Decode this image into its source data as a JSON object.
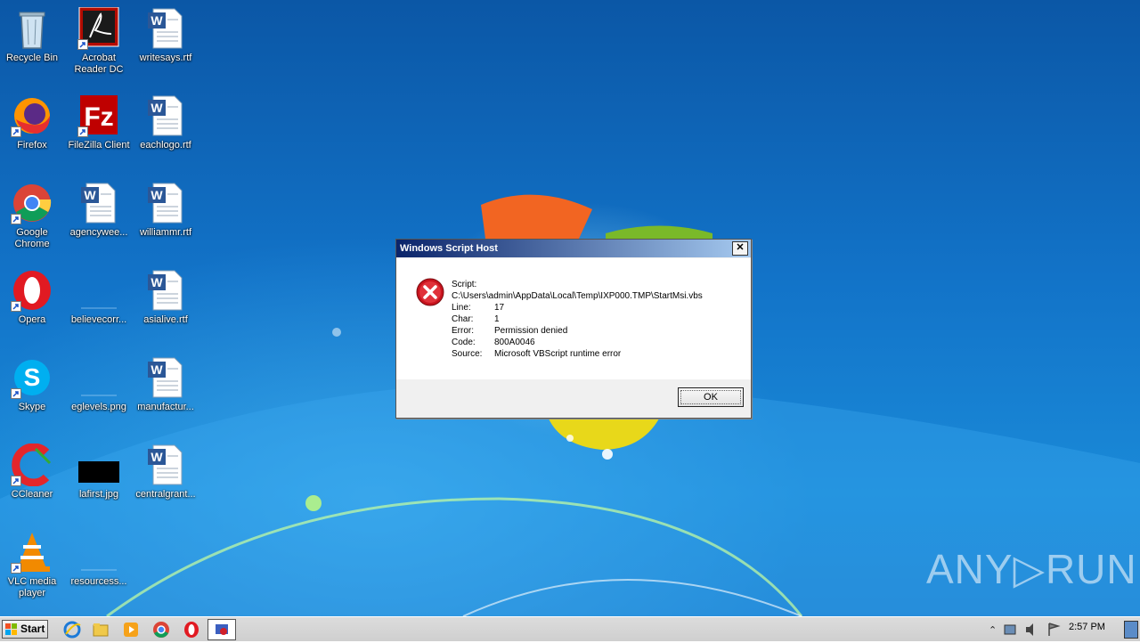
{
  "desktop": {
    "icons": [
      {
        "label": "Recycle Bin"
      },
      {
        "label": "Acrobat Reader DC"
      },
      {
        "label": "writesays.rtf"
      },
      {
        "label": "Firefox"
      },
      {
        "label": "FileZilla Client"
      },
      {
        "label": "eachlogo.rtf"
      },
      {
        "label": "Google Chrome"
      },
      {
        "label": "agencywee..."
      },
      {
        "label": "williammr.rtf"
      },
      {
        "label": "Opera"
      },
      {
        "label": "believecorr..."
      },
      {
        "label": "asialive.rtf"
      },
      {
        "label": "Skype"
      },
      {
        "label": "eglevels.png"
      },
      {
        "label": "manufactur..."
      },
      {
        "label": "CCleaner"
      },
      {
        "label": "lafirst.jpg"
      },
      {
        "label": "centralgrant..."
      },
      {
        "label": "VLC media player"
      },
      {
        "label": "resourcess..."
      }
    ]
  },
  "dialog": {
    "title": "Windows Script Host",
    "close_label": "✕",
    "script_label": "Script:",
    "script_path": "C:\\Users\\admin\\AppData\\Local\\Temp\\IXP000.TMP\\StartMsi.vbs",
    "fields": [
      {
        "key": "Line:",
        "value": "17"
      },
      {
        "key": "Char:",
        "value": "1"
      },
      {
        "key": "Error:",
        "value": "Permission denied"
      },
      {
        "key": "Code:",
        "value": "800A0046"
      },
      {
        "key": "Source:",
        "value": "Microsoft VBScript runtime error"
      }
    ],
    "ok_label": "OK"
  },
  "taskbar": {
    "start_label": "Start",
    "clock": "2:57 PM"
  },
  "watermark": "ANY▷RUN"
}
